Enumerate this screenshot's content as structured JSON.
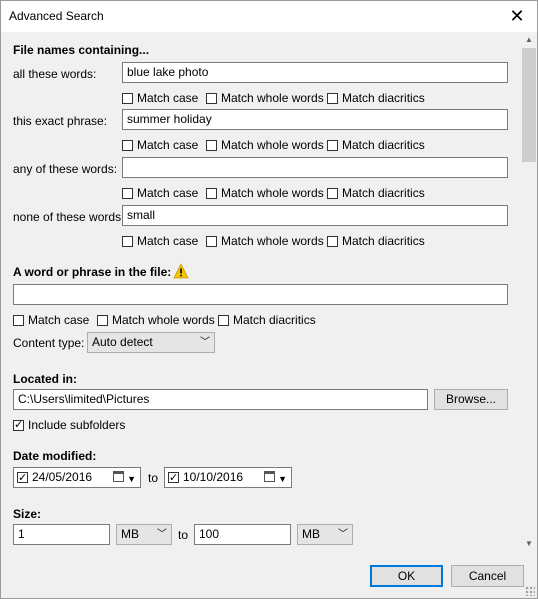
{
  "window": {
    "title": "Advanced Search"
  },
  "file_names": {
    "heading": "File names containing...",
    "rows": [
      {
        "label": "all these words:",
        "value": "blue lake photo"
      },
      {
        "label": "this exact phrase:",
        "value": "summer holiday"
      },
      {
        "label": "any of these words:",
        "value": ""
      },
      {
        "label": "none of these words:",
        "value": "small"
      }
    ],
    "options": {
      "match_case": "Match case",
      "match_whole_words": "Match whole words",
      "match_diacritics": "Match diacritics"
    }
  },
  "content_search": {
    "heading": "A word or phrase in the file:",
    "value": "",
    "options": {
      "match_case": "Match case",
      "match_whole_words": "Match whole words",
      "match_diacritics": "Match diacritics"
    },
    "content_type_label": "Content type:",
    "content_type_value": "Auto detect"
  },
  "location": {
    "heading": "Located in:",
    "path": "C:\\Users\\limited\\Pictures",
    "browse_label": "Browse...",
    "include_subfolders_label": "Include subfolders",
    "include_subfolders_checked": true
  },
  "date_modified": {
    "heading": "Date modified:",
    "from": "24/05/2016",
    "to_label": "to",
    "to": "10/10/2016"
  },
  "size": {
    "heading": "Size:",
    "min": "1",
    "min_unit": "MB",
    "to_label": "to",
    "max": "100",
    "max_unit": "MB"
  },
  "buttons": {
    "ok": "OK",
    "cancel": "Cancel"
  },
  "colors": {
    "accent": "#0078d7",
    "warning": "#f5c400"
  },
  "icons": {
    "close": "close-icon",
    "warning": "warning-icon",
    "calendar": "calendar-icon",
    "chevron": "chevron-down-icon"
  }
}
